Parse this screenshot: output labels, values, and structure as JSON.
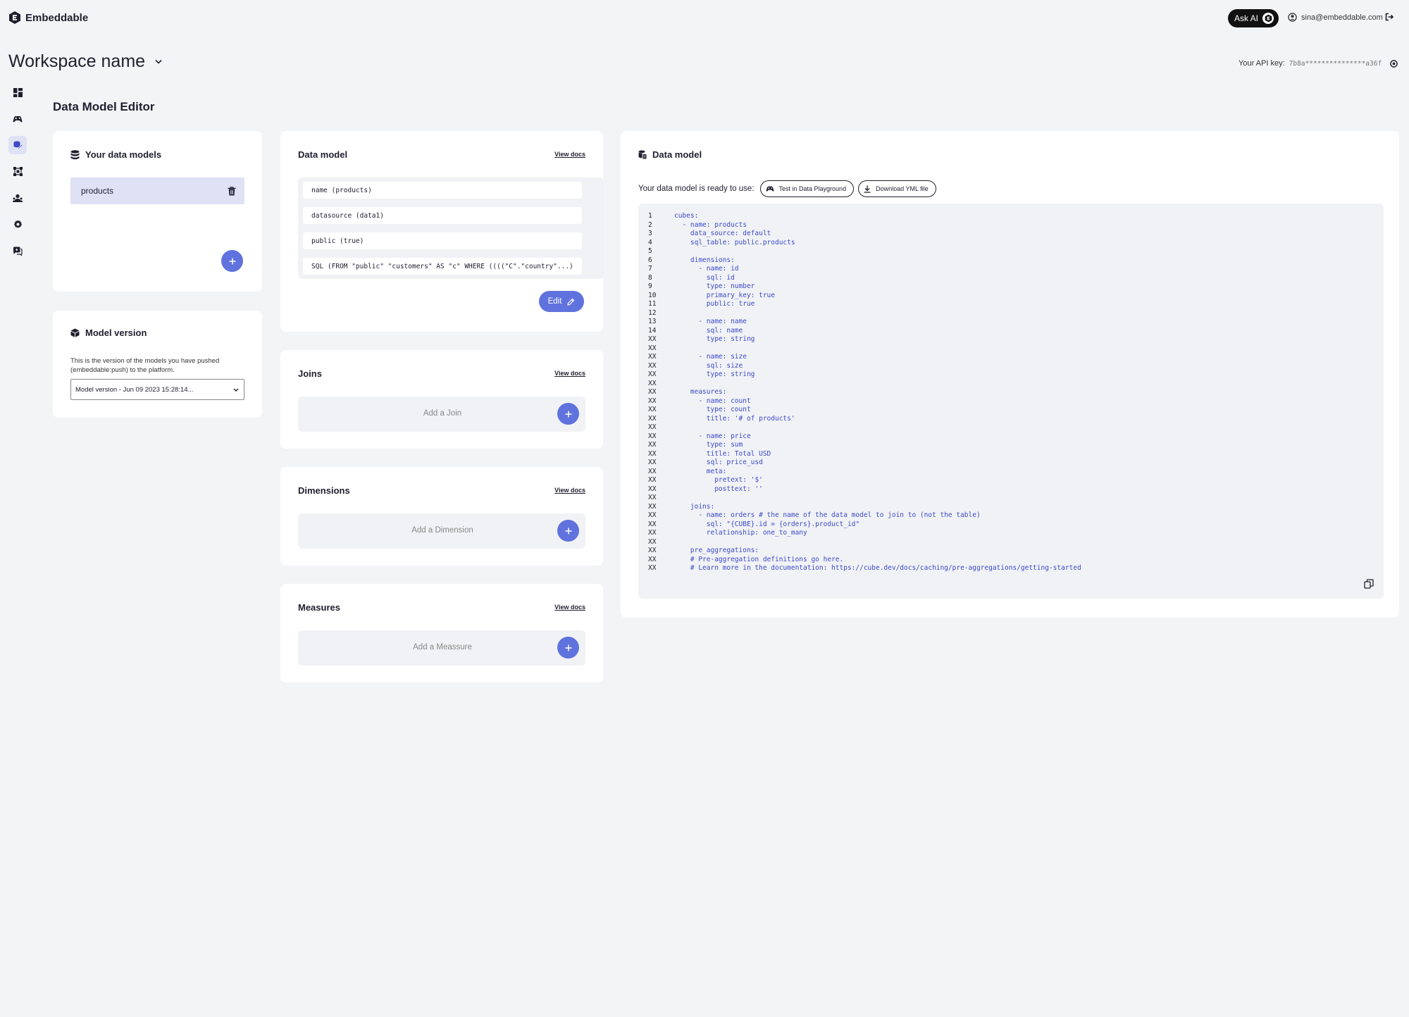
{
  "app": {
    "brand": "Embeddable"
  },
  "header": {
    "ask_ai_label": "Ask AI",
    "user_email": "sina@embeddable.com"
  },
  "workspace": {
    "name": "Workspace name",
    "api_key_label": "Your API key:",
    "api_key_value": "7b8a***************a36f"
  },
  "page": {
    "title": "Data Model Editor"
  },
  "your_models": {
    "title": "Your data models",
    "items": [
      {
        "label": "products"
      }
    ]
  },
  "model_version": {
    "title": "Model version",
    "description": "This is the version of the models you have pushed (embeddable:push) to the platform.",
    "selected": "Model version - Jun 09 2023 15:28:14..."
  },
  "data_model": {
    "title": "Data model",
    "view_docs": "View docs",
    "fields": [
      "name (products)",
      "datasource (data1)",
      "public (true)",
      "SQL (FROM \"public\" \"customers\" AS \"c\" WHERE ((((\"C\".\"country\"...)"
    ],
    "edit_label": "Edit"
  },
  "joins": {
    "title": "Joins",
    "view_docs": "View docs",
    "add_label": "Add a Join"
  },
  "dimensions": {
    "title": "Dimensions",
    "view_docs": "View docs",
    "add_label": "Add a Dimension"
  },
  "measures": {
    "title": "Measures",
    "view_docs": "View docs",
    "add_label": "Add a Meassure"
  },
  "yaml_panel": {
    "title": "Data model",
    "ready_text": "Your data model is ready to use:",
    "test_button": "Test in Data Playground",
    "download_button": "Download YML file",
    "lines": [
      {
        "n": "1",
        "t": "cubes:"
      },
      {
        "n": "2",
        "t": "  - name: products"
      },
      {
        "n": "3",
        "t": "    data_source: default"
      },
      {
        "n": "4",
        "t": "    sql_table: public.products"
      },
      {
        "n": "5",
        "t": ""
      },
      {
        "n": "6",
        "t": "    dimensions:"
      },
      {
        "n": "7",
        "t": "      - name: id"
      },
      {
        "n": "8",
        "t": "        sql: id"
      },
      {
        "n": "9",
        "t": "        type: number"
      },
      {
        "n": "10",
        "t": "        primary_key: true"
      },
      {
        "n": "11",
        "t": "        public: true"
      },
      {
        "n": "12",
        "t": ""
      },
      {
        "n": "13",
        "t": "      - name: name"
      },
      {
        "n": "14",
        "t": "        sql: name"
      },
      {
        "n": "XX",
        "t": "        type: string"
      },
      {
        "n": "XX",
        "t": ""
      },
      {
        "n": "XX",
        "t": "      - name: size"
      },
      {
        "n": "XX",
        "t": "        sql: size"
      },
      {
        "n": "XX",
        "t": "        type: string"
      },
      {
        "n": "XX",
        "t": ""
      },
      {
        "n": "XX",
        "t": "    measures:"
      },
      {
        "n": "XX",
        "t": "      - name: count"
      },
      {
        "n": "XX",
        "t": "        type: count"
      },
      {
        "n": "XX",
        "t": "        title: '# of products'"
      },
      {
        "n": "XX",
        "t": ""
      },
      {
        "n": "XX",
        "t": "      - name: price"
      },
      {
        "n": "XX",
        "t": "        type: sum"
      },
      {
        "n": "XX",
        "t": "        title: Total USD"
      },
      {
        "n": "XX",
        "t": "        sql: price_usd"
      },
      {
        "n": "XX",
        "t": "        meta:"
      },
      {
        "n": "XX",
        "t": "          pretext: '$'"
      },
      {
        "n": "XX",
        "t": "          posttext: ''"
      },
      {
        "n": "XX",
        "t": ""
      },
      {
        "n": "XX",
        "t": "    joins:"
      },
      {
        "n": "XX",
        "t": "      - name: orders # the name of the data model to join to (not the table)"
      },
      {
        "n": "XX",
        "t": "        sql: \"{CUBE}.id = {orders}.product_id\""
      },
      {
        "n": "XX",
        "t": "        relationship: one_to_many"
      },
      {
        "n": "XX",
        "t": ""
      },
      {
        "n": "XX",
        "t": "    pre_aggregations:"
      },
      {
        "n": "XX",
        "t": "    # Pre-aggregation definitions go here."
      },
      {
        "n": "XX",
        "t": "    # Learn more in the documentation: https://cube.dev/docs/caching/pre-aggregations/getting-started"
      }
    ]
  },
  "colors": {
    "accent": "#6072dd",
    "selected_bg": "#dfe1f5",
    "code": "#3b49c8"
  }
}
